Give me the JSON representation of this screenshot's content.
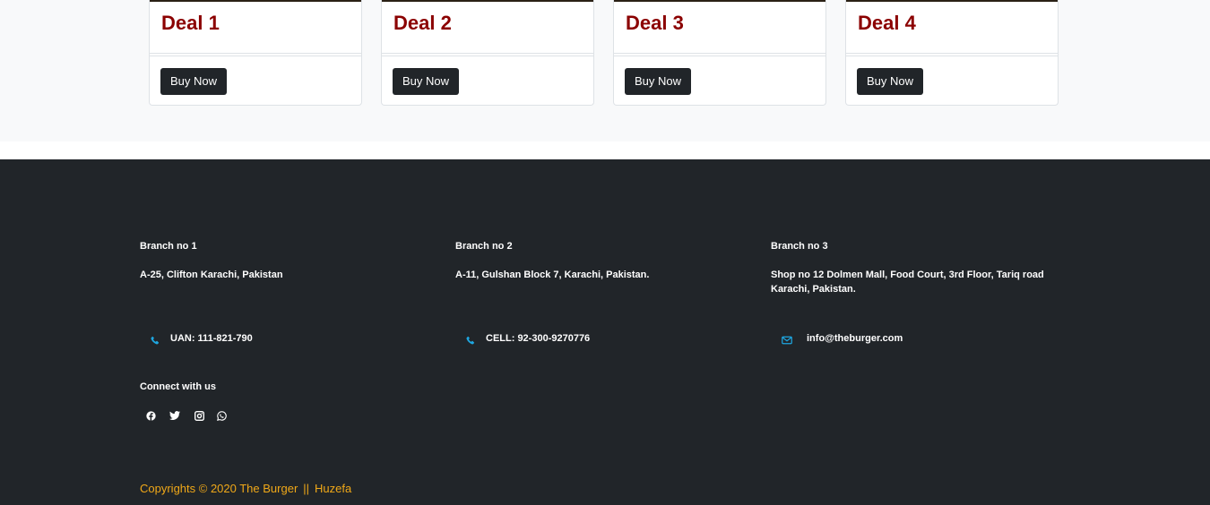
{
  "deals": [
    {
      "title": "Deal 1",
      "button_label": "Buy Now"
    },
    {
      "title": "Deal 2",
      "button_label": "Buy Now"
    },
    {
      "title": "Deal 3",
      "button_label": "Buy Now"
    },
    {
      "title": "Deal 4",
      "button_label": "Buy Now"
    }
  ],
  "footer": {
    "branches": [
      {
        "heading": "Branch no 1",
        "address": "A-25, Clifton Karachi, Pakistan",
        "contact": "UAN: 111-821-790",
        "contact_icon": "phone-icon"
      },
      {
        "heading": "Branch no 2",
        "address": "A-11, Gulshan Block 7, Karachi, Pakistan.",
        "contact": "CELL: 92-300-9270776",
        "contact_icon": "phone-icon"
      },
      {
        "heading": "Branch no 3",
        "address": "Shop no 12 Dolmen Mall, Food Court, 3rd Floor, Tariq road Karachi, Pakistan.",
        "contact": "info@theburger.com",
        "contact_icon": "envelope-icon"
      }
    ],
    "connect_heading": "Connect with us",
    "social_icons": [
      "facebook-icon",
      "twitter-icon",
      "instagram-icon",
      "whatsapp-icon"
    ],
    "copyright": {
      "text": "Copyrights © 2020 The Burger",
      "separator": "||",
      "author": "Huzefa"
    }
  },
  "colors": {
    "deal_title": "#8b0000",
    "button_bg": "#212529",
    "footer_bg": "#212529",
    "contact_icon": "#1ea7e1",
    "copyright": "#f0a818",
    "section_bg": "#f8f9fa"
  }
}
